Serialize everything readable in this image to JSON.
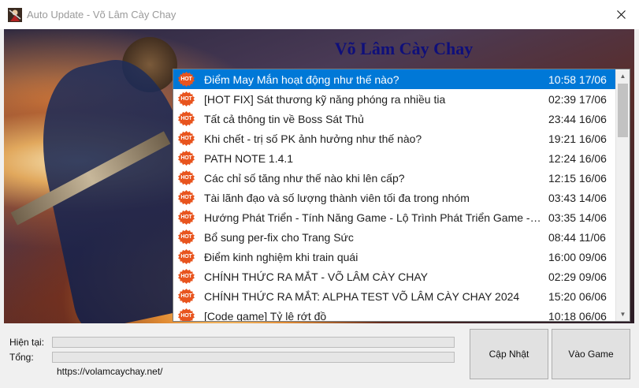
{
  "window": {
    "title": "Auto Update - Võ Lâm Cày Chay",
    "app_icon": "warrior-icon",
    "close_icon": "close-icon"
  },
  "banner": {
    "title": "Võ Lâm Cày Chay"
  },
  "news": {
    "badge": "HOT",
    "badge_color": "#e8541e",
    "selected_color": "#0078d7",
    "items": [
      {
        "title": "Điểm May Mắn hoạt động như thế nào?",
        "date": "10:58 17/06"
      },
      {
        "title": "[HOT FIX] Sát thương kỹ năng phóng ra nhiều tia",
        "date": "02:39 17/06"
      },
      {
        "title": "Tất cả thông tin về Boss Sát Thủ",
        "date": "23:44 16/06"
      },
      {
        "title": "Khi chết - trị số PK ảnh hưởng như thế nào?",
        "date": "19:21 16/06"
      },
      {
        "title": "PATH NOTE 1.4.1",
        "date": "12:24 16/06"
      },
      {
        "title": "Các chỉ số tăng như thế nào khi lên cấp?",
        "date": "12:15 16/06"
      },
      {
        "title": "Tài lãnh đạo và số lượng thành viên tối đa trong nhóm",
        "date": "03:43 14/06"
      },
      {
        "title": "Hướng Phát Triển - Tính Năng Game - Lộ Trình Phát Triển Game - H...",
        "date": "03:35 14/06"
      },
      {
        "title": "Bổ sung per-fix cho Trang Sức",
        "date": "08:44 11/06"
      },
      {
        "title": "Điểm kinh nghiệm khi train quái",
        "date": "16:00 09/06"
      },
      {
        "title": "CHÍNH THỨC RA MẮT - VÕ LÂM CÀY CHAY",
        "date": "02:29 09/06"
      },
      {
        "title": "CHÍNH THỨC RA MẮT: ALPHA TEST VÕ LÂM CÀY CHAY 2024",
        "date": "15:20 06/06"
      },
      {
        "title": "[Code game] Tỷ lệ rớt đồ",
        "date": "10:18 06/06"
      }
    ]
  },
  "progress": {
    "current_label": "Hiện tại:",
    "total_label": "Tổng:",
    "current_value": 0,
    "total_value": 0
  },
  "footer": {
    "url": "https://volamcaychay.net/"
  },
  "buttons": {
    "update": "Cập Nhật",
    "play": "Vào Game"
  }
}
